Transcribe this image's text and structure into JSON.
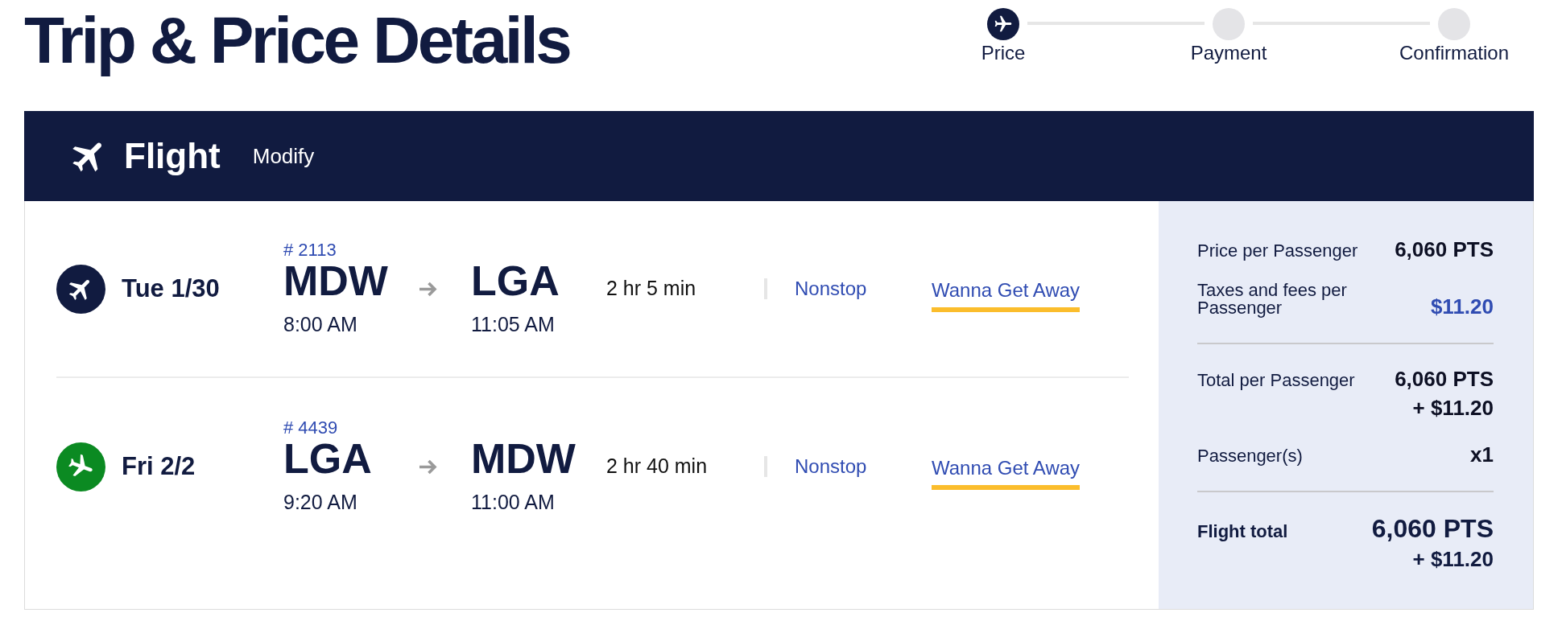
{
  "header": {
    "title": "Trip & Price Details",
    "steps": [
      {
        "label": "Price",
        "selected": true
      },
      {
        "label": "Payment",
        "selected": false
      },
      {
        "label": "Confirmation",
        "selected": false
      }
    ]
  },
  "section": {
    "title": "Flight",
    "action": "Modify"
  },
  "flights": [
    {
      "kind": "outbound",
      "color": "#111b40",
      "date": "Tue 1/30",
      "flight_number": "# 2113",
      "origin": {
        "code": "MDW",
        "time": "8:00 AM"
      },
      "destination": {
        "code": "LGA",
        "time": "11:05 AM"
      },
      "duration": "2 hr 5 min",
      "stops": "Nonstop",
      "fare": "Wanna Get Away"
    },
    {
      "kind": "return",
      "color": "#0b8a22",
      "date": "Fri 2/2",
      "flight_number": "# 4439",
      "origin": {
        "code": "LGA",
        "time": "9:20 AM"
      },
      "destination": {
        "code": "MDW",
        "time": "11:00 AM"
      },
      "duration": "2 hr 40 min",
      "stops": "Nonstop",
      "fare": "Wanna Get Away"
    }
  ],
  "summary": {
    "sections": [
      {
        "rows": [
          {
            "kind": "plain",
            "label": "Price per Passenger",
            "values": [
              "6,060 PTS"
            ]
          },
          {
            "kind": "link",
            "label": "Taxes and fees per Passenger",
            "values": [
              "$11.20"
            ]
          }
        ]
      },
      {
        "rows": [
          {
            "kind": "plain",
            "label": "Total per Passenger",
            "values": [
              "6,060 PTS",
              "+ $11.20"
            ]
          },
          {
            "kind": "plain",
            "label": "Passenger(s)",
            "values": [
              "x1"
            ]
          }
        ]
      },
      {
        "rows": [
          {
            "kind": "total",
            "label": "Flight total",
            "values": [
              "6,060 PTS",
              "+ $11.20"
            ]
          }
        ]
      }
    ]
  }
}
